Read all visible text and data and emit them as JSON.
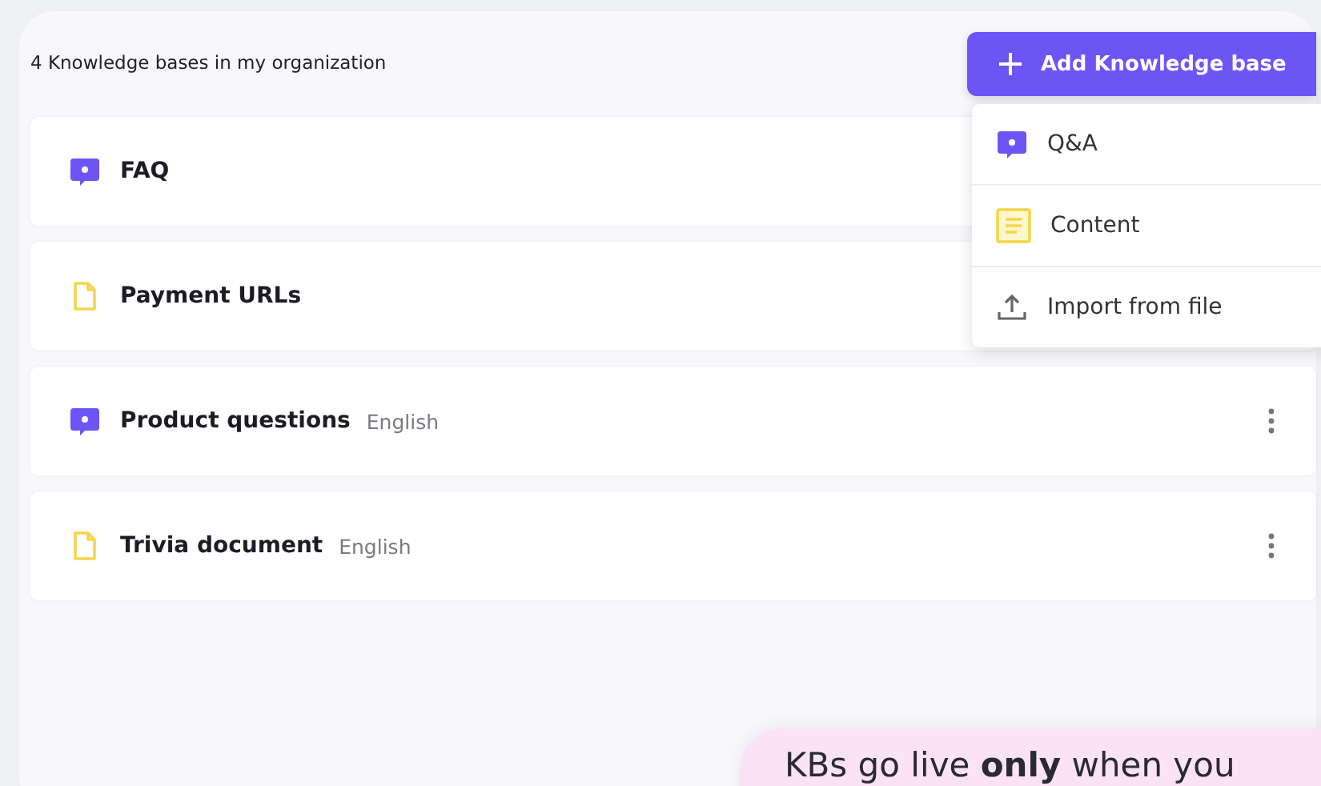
{
  "header": {
    "count_label": "4 Knowledge bases in my organization"
  },
  "add_button": {
    "label": "Add Knowledge base"
  },
  "add_menu": [
    {
      "kind": "qa",
      "label": "Q&A"
    },
    {
      "kind": "content",
      "label": "Content"
    },
    {
      "kind": "import",
      "label": "Import from file"
    }
  ],
  "knowledge_bases": [
    {
      "kind": "qa",
      "name": "FAQ"
    },
    {
      "kind": "content",
      "name": "Payment URLs"
    },
    {
      "kind": "qa",
      "name": "Product questions",
      "language": "English"
    },
    {
      "kind": "content",
      "name": "Trivia document",
      "language": "English"
    }
  ],
  "callout": {
    "text": "KBs go live **only** when you"
  }
}
